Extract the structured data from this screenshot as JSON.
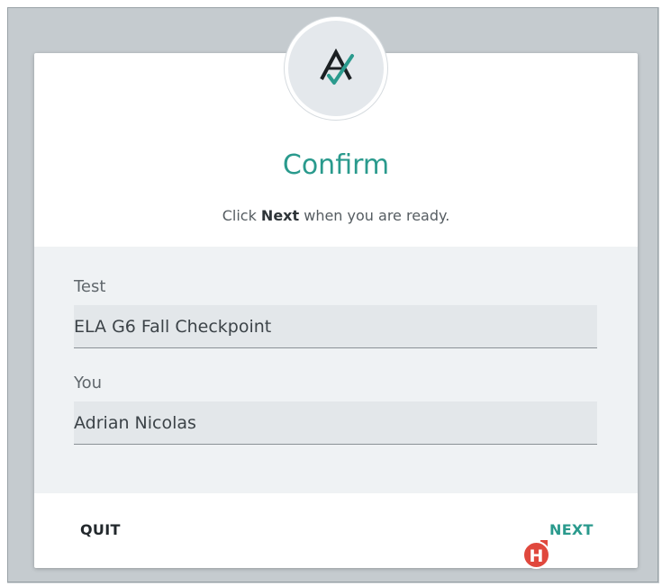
{
  "header": {
    "logo_letter": "A",
    "title": "Confirm",
    "instruction_prefix": "Click",
    "instruction_bold": "Next",
    "instruction_suffix": "when you are ready."
  },
  "fields": {
    "test": {
      "label": "Test",
      "value": "ELA G6 Fall Checkpoint"
    },
    "you": {
      "label": "You",
      "value": "Adrian Nicolas"
    }
  },
  "actions": {
    "quit_label": "QUIT",
    "next_label": "NEXT"
  },
  "overlay": {
    "badge_letter": "H"
  },
  "colors": {
    "accent": "#2a9a8d",
    "badge": "#e0483d",
    "background": "#c5cbcf"
  }
}
